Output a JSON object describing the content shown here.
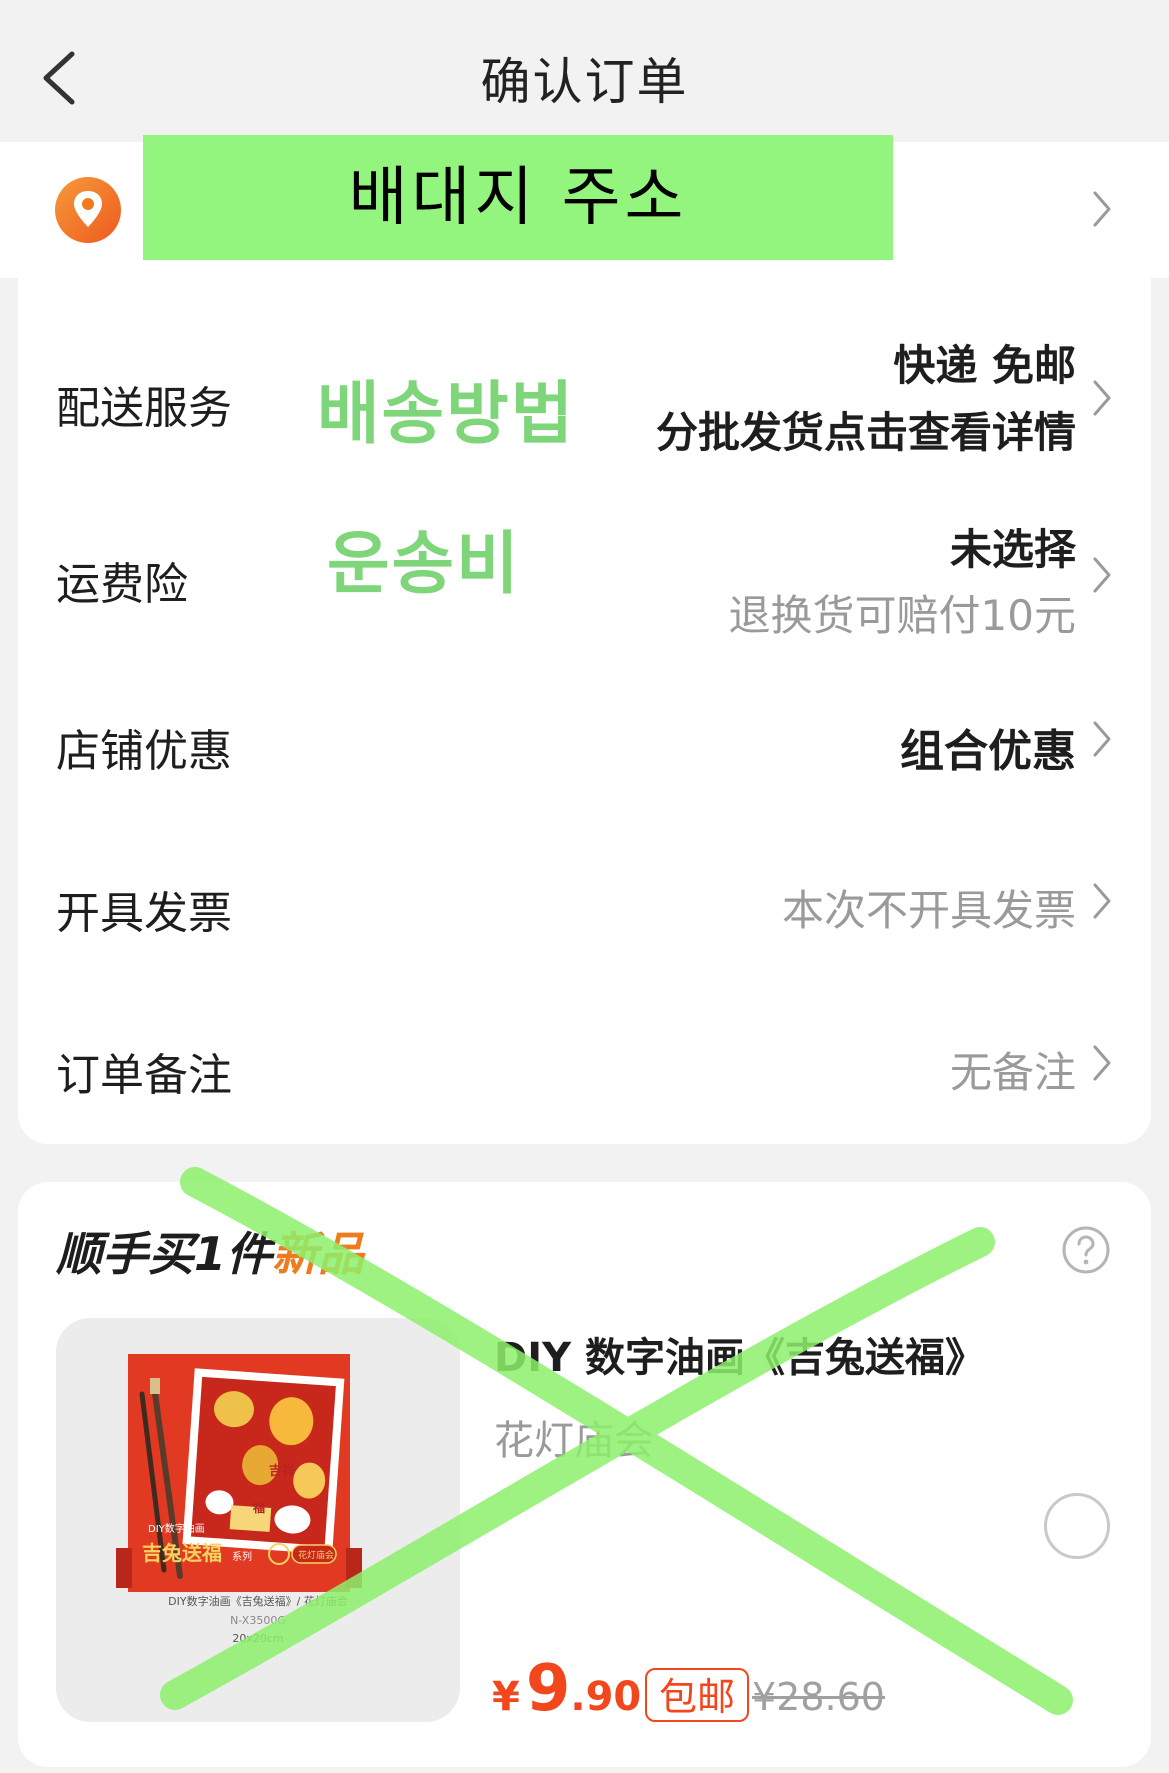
{
  "nav": {
    "title": "确认订单"
  },
  "address": {
    "label": "배대지 주소"
  },
  "options": [
    {
      "label": "配送服务",
      "value_line1": "快递 免邮",
      "value_line2": "分批发货点击查看详情",
      "annotation": "배송방법"
    },
    {
      "label": "运费险",
      "value_line1": "未选择",
      "value_line2": "退换货可赔付10元",
      "annotation": "운송비"
    },
    {
      "label": "店铺优惠",
      "value_line1": "组合优惠"
    },
    {
      "label": "开具发票",
      "value_line1": "本次不开具发票"
    },
    {
      "label": "订单备注",
      "value_line1": "无备注"
    }
  ],
  "recommend": {
    "title_main": "顺手买1件",
    "title_tag": "新品",
    "product_name_prefix": "DIY 数字油画《",
    "product_name_highlight": "吉兔送福",
    "product_name_suffix": "》",
    "product_variant": "花灯庙会",
    "price_symbol": "¥",
    "price_integer": "9",
    "price_decimal": ".90",
    "shipping_badge": "包邮",
    "original_price": "¥28.60",
    "box": {
      "series_top": "DIY数字油画",
      "series_name": "吉兔送福",
      "series_suffix": "系列",
      "seal": "花灯庙会",
      "caption": "DIY数字油画《吉兔送福》/ 花灯庙会",
      "code": "N-X3500G",
      "size": "20x20cm",
      "tag1": "吉祥",
      "tag2": "福"
    }
  },
  "colors": {
    "accent": "#f2461d",
    "overlay_green": "#93f57d",
    "annotation_green": "#7fd67a",
    "pin_orange": "#f07a1e"
  }
}
